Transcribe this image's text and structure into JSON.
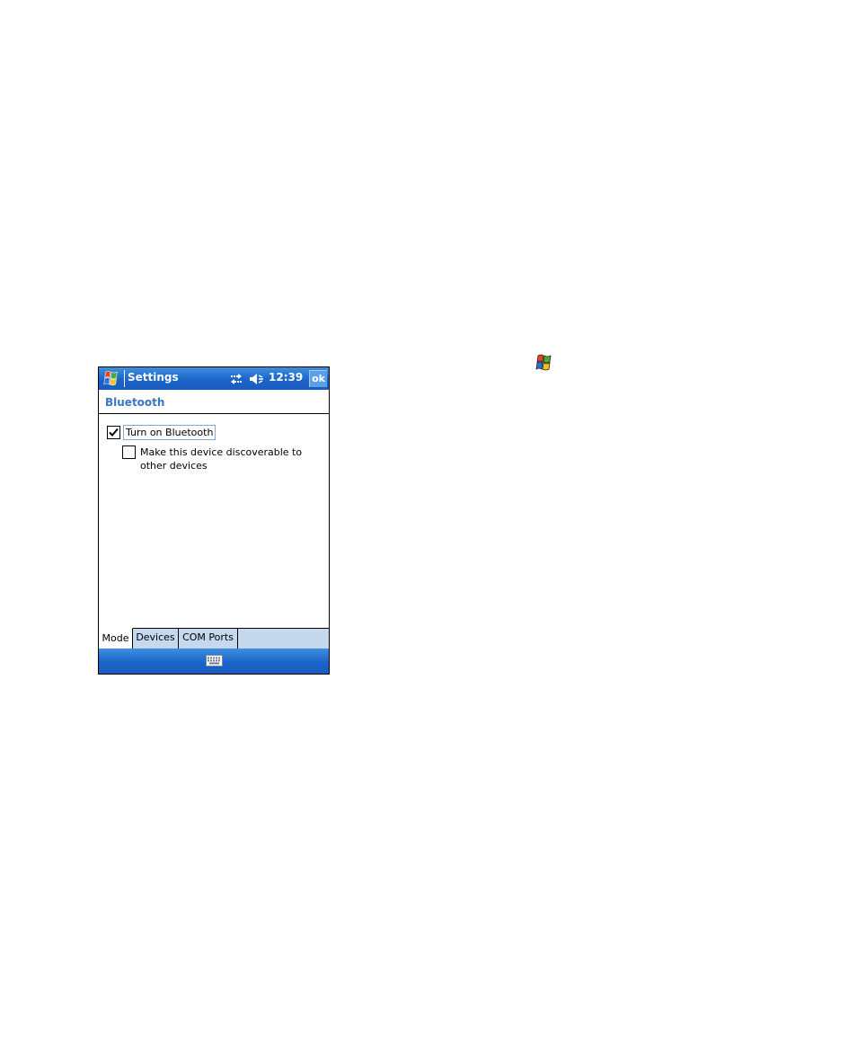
{
  "title_bar": {
    "app_title": "Settings",
    "clock": "12:39",
    "ok_label": "ok",
    "start_icon": "windows-flag-icon",
    "connectivity_icon": "connectivity-arrows-icon",
    "volume_icon": "speaker-muted-icon"
  },
  "page": {
    "header": "Bluetooth"
  },
  "options": [
    {
      "label": "Turn on Bluetooth",
      "checked": true
    },
    {
      "label": "Make this device discoverable to other devices",
      "checked": false
    }
  ],
  "tabs": [
    {
      "label": "Mode",
      "active": true
    },
    {
      "label": "Devices",
      "active": false
    },
    {
      "label": "COM Ports",
      "active": false
    }
  ],
  "menu_bar": {
    "sip_icon": "keyboard-icon"
  },
  "colors": {
    "title_bar_blue": "#1b64c8",
    "header_text_blue": "#3a76c4",
    "tab_strip": "#c6d8ee"
  }
}
